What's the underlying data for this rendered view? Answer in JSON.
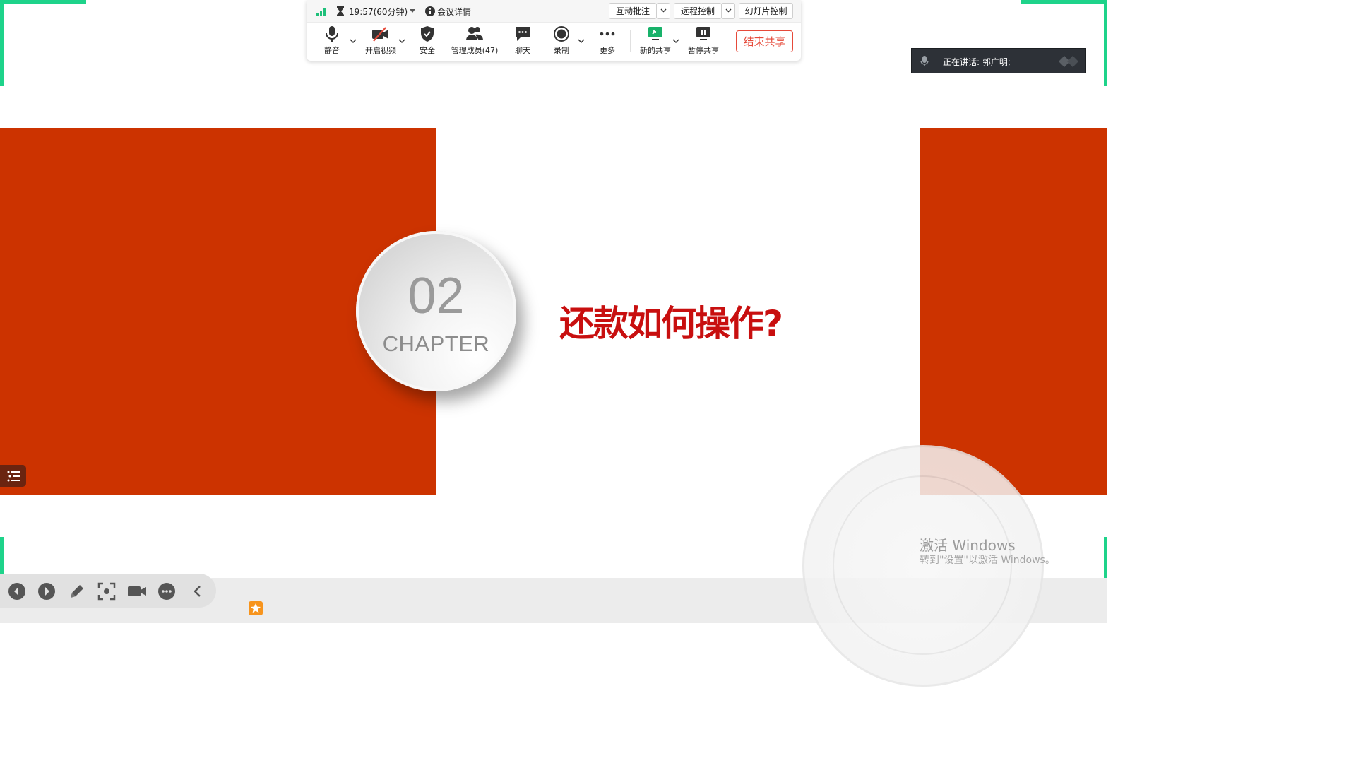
{
  "toolbar": {
    "timer": "19:57(60分钟)",
    "meeting_info": "会议详情",
    "annotate": "互动批注",
    "remote_control": "远程控制",
    "slide_control": "幻灯片控制",
    "tools": {
      "mute": "静音",
      "video": "开启视频",
      "security": "安全",
      "participants": "管理成员(47)",
      "chat": "聊天",
      "record": "录制",
      "more": "更多",
      "new_share": "新的共享",
      "pause_share": "暂停共享"
    },
    "end_share": "结束共享"
  },
  "speaking": {
    "text": "正在讲话:  郭广明;"
  },
  "slide": {
    "chapter_number": "02",
    "chapter_word": "CHAPTER",
    "title": "还款如何操作?"
  },
  "watermark": {
    "title": "激活 Windows",
    "subtitle": "转到\"设置\"以激活 Windows。"
  },
  "colors": {
    "slide_red": "#cc3300",
    "title_red": "#c80f0f",
    "frame_green": "#1ed38a",
    "end_share_red": "#e64a3a"
  },
  "icons": {
    "signal": "signal-icon",
    "timer": "hourglass-icon",
    "info": "info-icon",
    "mic": "microphone-icon",
    "video": "video-off-icon",
    "security": "shield-icon",
    "participants": "users-icon",
    "chat": "chat-icon",
    "record": "record-icon",
    "more": "more-icon",
    "new_share": "share-screen-icon",
    "pause_share": "pause-share-icon"
  }
}
